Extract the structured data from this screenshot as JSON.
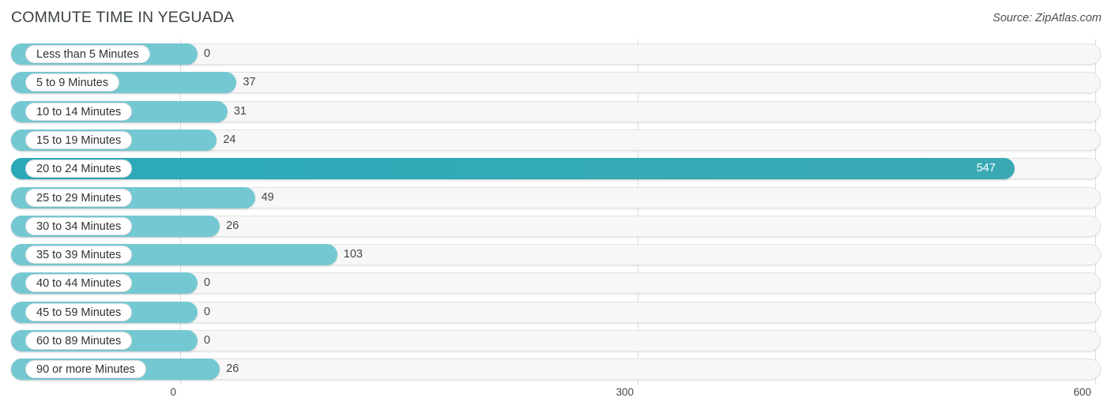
{
  "header": {
    "title": "COMMUTE TIME IN YEGUADA",
    "source": "Source: ZipAtlas.com"
  },
  "colors": {
    "bar": "#74c8d2",
    "bar_max": "#2ba8b8",
    "track": "#f7f7f7",
    "track_border": "#e3e3e3",
    "gridline": "#dcdcdc",
    "text": "#40464a",
    "title_text": "#3c4245",
    "value_inside_text": "#ffffff"
  },
  "chart_data": {
    "type": "bar",
    "orientation": "horizontal",
    "title": "COMMUTE TIME IN YEGUADA",
    "source": "Source: ZipAtlas.com",
    "xlabel": "",
    "ylabel": "",
    "xlim": [
      0,
      600
    ],
    "grid": true,
    "legend": false,
    "axis_ticks": [
      "0",
      "300",
      "600"
    ],
    "axis_tick_values": [
      0,
      300,
      600
    ],
    "highlight_category": "20 to 24 Minutes",
    "categories": [
      "Less than 5 Minutes",
      "5 to 9 Minutes",
      "10 to 14 Minutes",
      "15 to 19 Minutes",
      "20 to 24 Minutes",
      "25 to 29 Minutes",
      "30 to 34 Minutes",
      "35 to 39 Minutes",
      "40 to 44 Minutes",
      "45 to 59 Minutes",
      "60 to 89 Minutes",
      "90 or more Minutes"
    ],
    "values": [
      0,
      37,
      31,
      24,
      547,
      49,
      26,
      103,
      0,
      0,
      0,
      26
    ],
    "value_labels": [
      "0",
      "37",
      "31",
      "24",
      "547",
      "49",
      "26",
      "103",
      "0",
      "0",
      "0",
      "26"
    ]
  }
}
